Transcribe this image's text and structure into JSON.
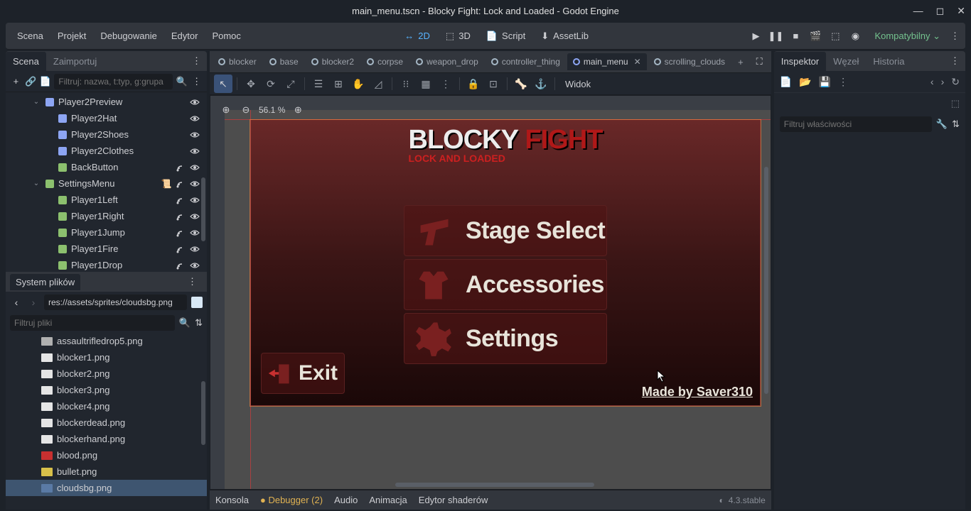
{
  "titlebar": {
    "title": "main_menu.tscn - Blocky Fight: Lock and Loaded - Godot Engine"
  },
  "menubar": {
    "items": [
      "Scena",
      "Projekt",
      "Debugowanie",
      "Edytor",
      "Pomoc"
    ],
    "modes": {
      "m2d": "2D",
      "m3d": "3D",
      "script": "Script",
      "assetlib": "AssetLib"
    },
    "renderer": "Kompatybilny"
  },
  "scene_dock": {
    "tab_scene": "Scena",
    "tab_import": "Zaimportuj",
    "filter_placeholder": "Filtruj: nazwa, t:typ, g:grupa",
    "nodes": [
      {
        "label": "Player2Preview",
        "indent": 28,
        "expand": "⌄",
        "icon": "#8da5f3",
        "signals": false
      },
      {
        "label": "Player2Hat",
        "indent": 46,
        "expand": "",
        "icon": "#8da5f3",
        "signals": false
      },
      {
        "label": "Player2Shoes",
        "indent": 46,
        "expand": "",
        "icon": "#8da5f3",
        "signals": false
      },
      {
        "label": "Player2Clothes",
        "indent": 46,
        "expand": "",
        "icon": "#8da5f3",
        "signals": false
      },
      {
        "label": "BackButton",
        "indent": 46,
        "expand": "",
        "icon": "#8cc06e",
        "signals": true
      },
      {
        "label": "SettingsMenu",
        "indent": 28,
        "expand": "⌄",
        "icon": "#8cc06e",
        "signals": true,
        "script": true
      },
      {
        "label": "Player1Left",
        "indent": 46,
        "expand": "",
        "icon": "#8cc06e",
        "signals": true
      },
      {
        "label": "Player1Right",
        "indent": 46,
        "expand": "",
        "icon": "#8cc06e",
        "signals": true
      },
      {
        "label": "Player1Jump",
        "indent": 46,
        "expand": "",
        "icon": "#8cc06e",
        "signals": true
      },
      {
        "label": "Player1Fire",
        "indent": 46,
        "expand": "",
        "icon": "#8cc06e",
        "signals": true
      },
      {
        "label": "Player1Drop",
        "indent": 46,
        "expand": "",
        "icon": "#8cc06e",
        "signals": true
      }
    ]
  },
  "filesystem": {
    "title": "System plików",
    "path": "res://assets/sprites/cloudsbg.png",
    "filter_placeholder": "Filtruj pliki",
    "files": [
      {
        "label": "assaultrifledrop5.png",
        "color": "#b0b0b0",
        "selected": false
      },
      {
        "label": "blocker1.png",
        "color": "#e5e5e5",
        "selected": false
      },
      {
        "label": "blocker2.png",
        "color": "#e5e5e5",
        "selected": false
      },
      {
        "label": "blocker3.png",
        "color": "#e5e5e5",
        "selected": false
      },
      {
        "label": "blocker4.png",
        "color": "#e5e5e5",
        "selected": false
      },
      {
        "label": "blockerdead.png",
        "color": "#e5e5e5",
        "selected": false
      },
      {
        "label": "blockerhand.png",
        "color": "#e5e5e5",
        "selected": false
      },
      {
        "label": "blood.png",
        "color": "#c83030",
        "selected": false
      },
      {
        "label": "bullet.png",
        "color": "#d8c04a",
        "selected": false
      },
      {
        "label": "cloudsbg.png",
        "color": "#5a7aa5",
        "selected": true
      }
    ]
  },
  "scene_tabs": {
    "tabs": [
      {
        "label": "blocker",
        "active": false
      },
      {
        "label": "base",
        "active": false
      },
      {
        "label": "blocker2",
        "active": false
      },
      {
        "label": "corpse",
        "active": false
      },
      {
        "label": "weapon_drop",
        "active": false
      },
      {
        "label": "controller_thing",
        "active": false
      },
      {
        "label": "main_menu",
        "active": true
      },
      {
        "label": "scrolling_clouds",
        "active": false
      }
    ]
  },
  "viewport": {
    "zoom": "56.1 %",
    "view_label": "Widok",
    "game": {
      "title_a": "BLOCKY",
      "title_b": "FIGHT",
      "subtitle": "LOCK AND LOADED",
      "btn_stage": "Stage Select",
      "btn_acc": "Accessories",
      "btn_settings": "Settings",
      "btn_exit": "Exit",
      "credit": "Made by Saver310"
    }
  },
  "bottom": {
    "tabs": [
      "Konsola",
      "Debugger (2)",
      "Audio",
      "Animacja",
      "Edytor shaderów"
    ],
    "version": "4.3.stable"
  },
  "inspector": {
    "tab_inspector": "Inspektor",
    "tab_node": "Węzeł",
    "tab_history": "Historia",
    "filter_placeholder": "Filtruj właściwości"
  }
}
